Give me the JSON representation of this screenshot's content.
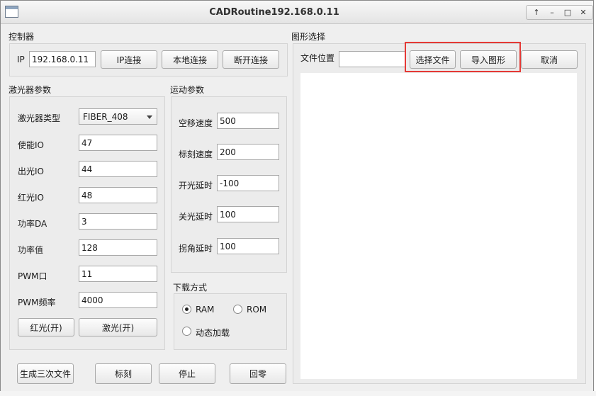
{
  "window": {
    "title": "CADRoutine192.168.0.11",
    "controls": [
      "↑",
      "–",
      "□",
      "✕"
    ]
  },
  "controller": {
    "section_title": "控制器",
    "ip_label": "IP",
    "ip_value": "192.168.0.11",
    "ip_connect": "IP连接",
    "local_connect": "本地连接",
    "disconnect": "断开连接"
  },
  "laser": {
    "section_title": "激光器参数",
    "type_label": "激光器类型",
    "type_value": "FIBER_408",
    "fields": [
      {
        "label": "使能IO",
        "value": "47"
      },
      {
        "label": "出光IO",
        "value": "44"
      },
      {
        "label": "红光IO",
        "value": "48"
      },
      {
        "label": "功率DA",
        "value": "3"
      },
      {
        "label": "功率值",
        "value": "128"
      },
      {
        "label": "PWM口",
        "value": "11"
      },
      {
        "label": "PWM频率",
        "value": "4000"
      }
    ],
    "red_light_button": "红光(开)",
    "laser_button": "激光(开)"
  },
  "motion": {
    "section_title": "运动参数",
    "fields": [
      {
        "label": "空移速度",
        "value": "500"
      },
      {
        "label": "标刻速度",
        "value": "200"
      },
      {
        "label": "开光延时",
        "value": "-100"
      },
      {
        "label": "关光延时",
        "value": "100"
      },
      {
        "label": "拐角延时",
        "value": "100"
      }
    ]
  },
  "download": {
    "section_title": "下载方式",
    "ram": "RAM",
    "rom": "ROM",
    "dynamic": "动态加载",
    "selected": "RAM"
  },
  "graphic": {
    "section_title": "图形选择",
    "file_label": "文件位置",
    "file_value": "",
    "select_file": "选择文件",
    "import_graphic": "导入图形",
    "cancel": "取消"
  },
  "bottom": {
    "generate": "生成三次文件",
    "mark": "标刻",
    "stop": "停止",
    "home": "回零"
  },
  "colors": {
    "highlight": "#e53935"
  }
}
